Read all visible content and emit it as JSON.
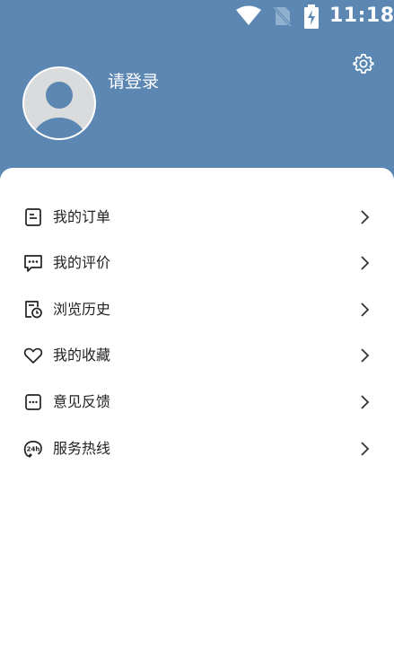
{
  "status_bar": {
    "time": "11:18",
    "icons": [
      "wifi-icon",
      "no-sim-icon",
      "battery-charging-icon"
    ]
  },
  "header": {
    "login_label": "请登录",
    "background_color": "#5b87b2",
    "settings_icon": "gear-icon",
    "avatar_icon": "default-avatar-icon"
  },
  "menu": {
    "items": [
      {
        "label": "我的订单",
        "icon": "order-icon"
      },
      {
        "label": "我的评价",
        "icon": "comment-icon"
      },
      {
        "label": "浏览历史",
        "icon": "history-icon"
      },
      {
        "label": "我的收藏",
        "icon": "heart-icon"
      },
      {
        "label": "意见反馈",
        "icon": "feedback-icon"
      },
      {
        "label": "服务热线",
        "icon": "hotline-24h-icon"
      }
    ]
  }
}
